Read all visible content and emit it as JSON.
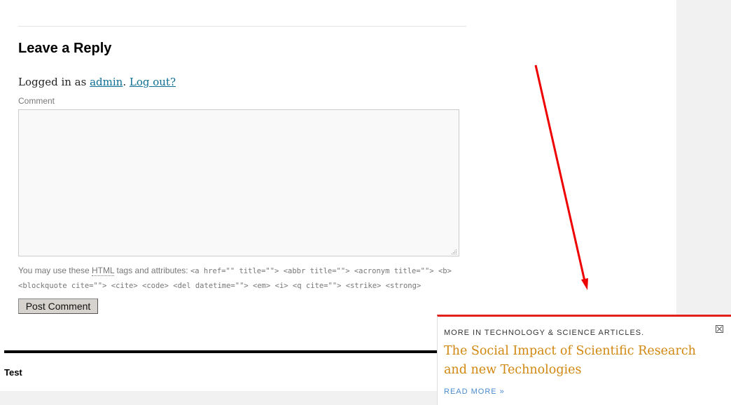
{
  "reply": {
    "title": "Leave a Reply",
    "logged_in_prefix": "Logged in as ",
    "username": "admin",
    "logged_in_sep": ".",
    "logout_label": "Log out?",
    "comment_label": "Comment",
    "comment_value": "",
    "allowed_prefix": "You may use these ",
    "allowed_abbr": "HTML",
    "allowed_middle": " tags and attributes: ",
    "allowed_tags": "<a href=\"\" title=\"\"> <abbr title=\"\"> <acronym title=\"\"> <b> <blockquote cite=\"\"> <cite> <code> <del datetime=\"\"> <em> <i> <q cite=\"\"> <strike> <strong>",
    "submit_label": "Post Comment"
  },
  "footer": {
    "text": "Test"
  },
  "popup": {
    "heading": "MORE IN TECHNOLOGY & SCIENCE ARTICLES.",
    "title": "The Social Impact of Scientific Research and new Technologies",
    "read_more": "READ MORE »",
    "accent_color": "#e2211c",
    "title_color": "#d1870f",
    "close_icon": "close-icon"
  },
  "annotation": {
    "arrow_color": "#ee0000"
  }
}
